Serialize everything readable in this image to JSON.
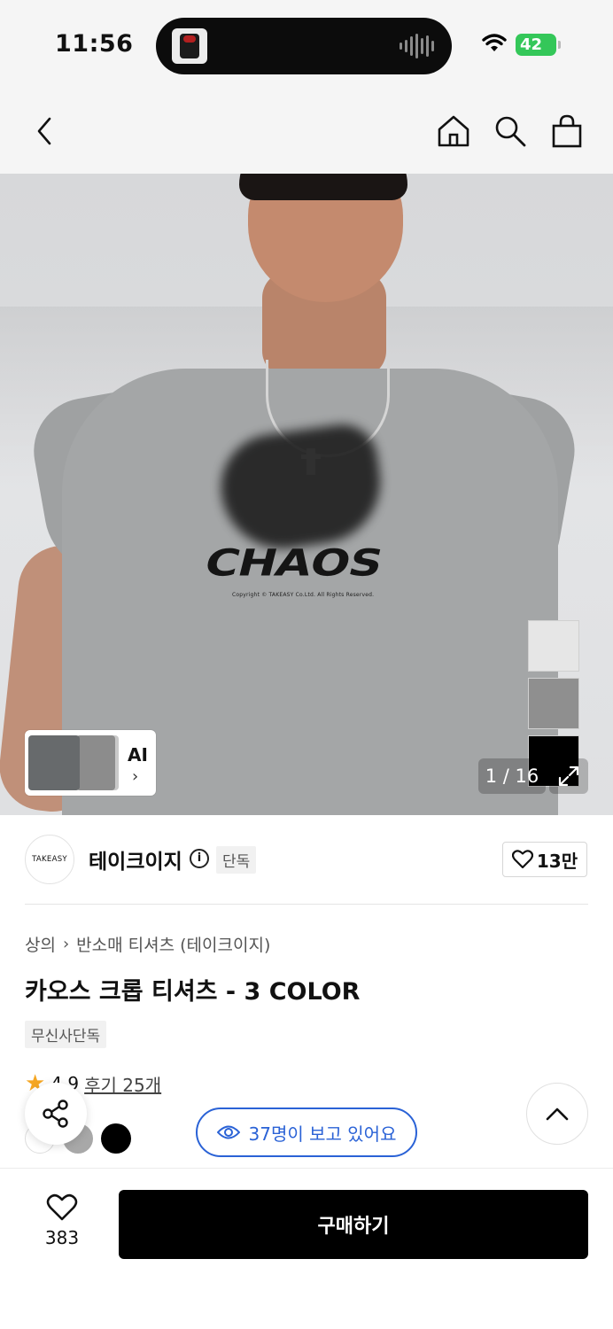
{
  "status_bar": {
    "time": "11:56",
    "battery": "42"
  },
  "nav": {
    "back_icon": "chevron-left-icon",
    "home_icon": "home-icon",
    "search_icon": "search-icon",
    "bag_icon": "shopping-bag-icon"
  },
  "hero": {
    "print_text": "CHAOS",
    "print_copy": "Copyright © TAKEASY Co.Ltd. All Rights Reserved.",
    "swatches": [
      "#e6e6e6",
      "#8f8f8f",
      "#000000"
    ],
    "ai_label": "AI",
    "page_counter": "1 / 16"
  },
  "brand": {
    "logo_text": "TAKEASY",
    "name": "테이크이지",
    "exclusive_tag": "단독",
    "likes": "13만"
  },
  "product": {
    "breadcrumb": [
      "상의",
      "반소매 티셔츠 (테이크이지)"
    ],
    "title": "카오스 크롭 티셔츠 - 3 COLOR",
    "tag": "무신사단독",
    "rating": "4.9",
    "reviews": "후기 25개",
    "colors": [
      "#ffffff",
      "#a8a8a8",
      "#000000"
    ],
    "viewers": "37명이 보고 있어요"
  },
  "bottom_bar": {
    "wish_count": "383",
    "buy_label": "구매하기"
  },
  "colors": {
    "accent_blue": "#2a62d6",
    "star": "#f5a623",
    "battery_green": "#34c759"
  }
}
